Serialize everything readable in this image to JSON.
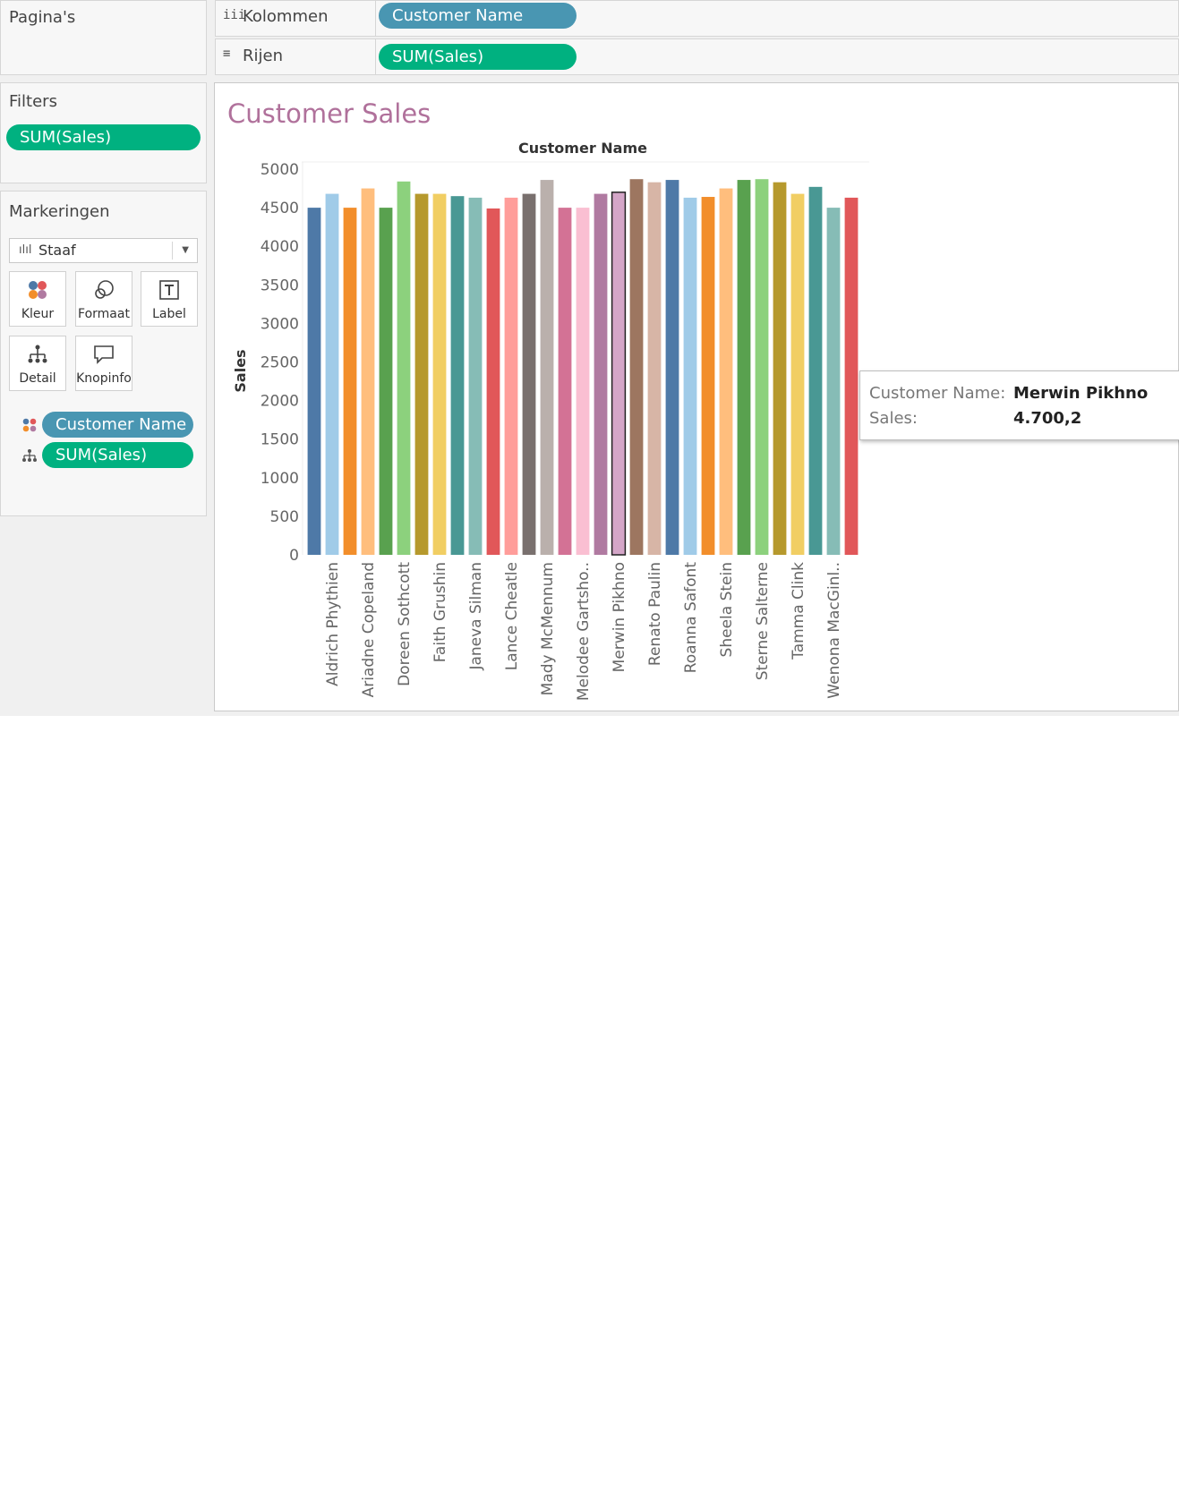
{
  "pages_card": {
    "title": "Pagina's"
  },
  "shelves": {
    "columns": {
      "icon": "columns-icon",
      "label": "Kolommen",
      "pill": "Customer Name"
    },
    "rows": {
      "icon": "rows-icon",
      "label": "Rijen",
      "pill": "SUM(Sales)"
    }
  },
  "filters_card": {
    "title": "Filters",
    "pill": "SUM(Sales)"
  },
  "marks_card": {
    "title": "Markeringen",
    "mark_type": {
      "icon": "bar-chart-icon",
      "label": "Staaf"
    },
    "buttons": [
      {
        "icon": "color-icon",
        "label": "Kleur"
      },
      {
        "icon": "size-icon",
        "label": "Formaat"
      },
      {
        "icon": "text-icon",
        "label": "Label"
      },
      {
        "icon": "detail-icon",
        "label": "Detail"
      },
      {
        "icon": "tooltip-icon",
        "label": "Knopinfo"
      }
    ],
    "fields": [
      {
        "icon": "color-icon",
        "label": "Customer Name"
      },
      {
        "icon": "detail-icon",
        "label": "SUM(Sales)"
      }
    ]
  },
  "colors": {
    "dimension_pill": "#4996b2",
    "measure_pill": "#00b180",
    "title": "#b0719b"
  },
  "chart_data": {
    "type": "bar",
    "title": "Customer Sales",
    "top_axis_label": "Customer Name",
    "ylabel": "Sales",
    "ylim": [
      0,
      5000
    ],
    "yticks": [
      0,
      500,
      1000,
      1500,
      2000,
      2500,
      3000,
      3500,
      4000,
      4500,
      5000
    ],
    "grid": false,
    "categories": [
      "",
      "Aldrich Phythien",
      "",
      "Ariadne Copeland",
      "",
      "Doreen Sothcott",
      "",
      "Faith Grushin",
      "",
      "Janeva Silman",
      "",
      "Lance Cheatle",
      "",
      "Mady McMennum",
      "",
      "Melodee Gartsho..",
      "",
      "Merwin Pikhno",
      "",
      "Renato Paulin",
      "",
      "Roanna Safont",
      "",
      "Sheela Stein",
      "",
      "Sterne Salterne",
      "",
      "Tamma Clink",
      "",
      "Wenona MacGinl..",
      ""
    ],
    "values": [
      4500,
      4680,
      4500,
      4750,
      4500,
      4840,
      4680,
      4680,
      4650,
      4630,
      4490,
      4630,
      4680,
      4860,
      4500,
      4500,
      4680,
      4700.2,
      4870,
      4830,
      4860,
      4630,
      4640,
      4750,
      4860,
      4870,
      4830,
      4680,
      4770,
      4500,
      4630
    ],
    "bar_colors": [
      "#4e79a7",
      "#a0cbe8",
      "#f28e2b",
      "#ffbe7d",
      "#59a14f",
      "#8cd17d",
      "#b6992d",
      "#f1ce63",
      "#499894",
      "#86bcb6",
      "#e15759",
      "#ff9d9a",
      "#79706e",
      "#bab0ac",
      "#d37295",
      "#fabfd2",
      "#b07aa1",
      "#d4a6c8",
      "#9d7660",
      "#d7b5a6",
      "#4e79a7",
      "#a0cbe8",
      "#f28e2b",
      "#ffbe7d",
      "#59a14f",
      "#8cd17d",
      "#b6992d",
      "#f1ce63",
      "#499894",
      "#86bcb6",
      "#e15759"
    ],
    "selected_index": 17
  },
  "tooltip": {
    "rows": [
      {
        "key": "Customer Name:",
        "value": "Merwin Pikhno"
      },
      {
        "key": "Sales:",
        "value": "4.700,2"
      }
    ]
  }
}
